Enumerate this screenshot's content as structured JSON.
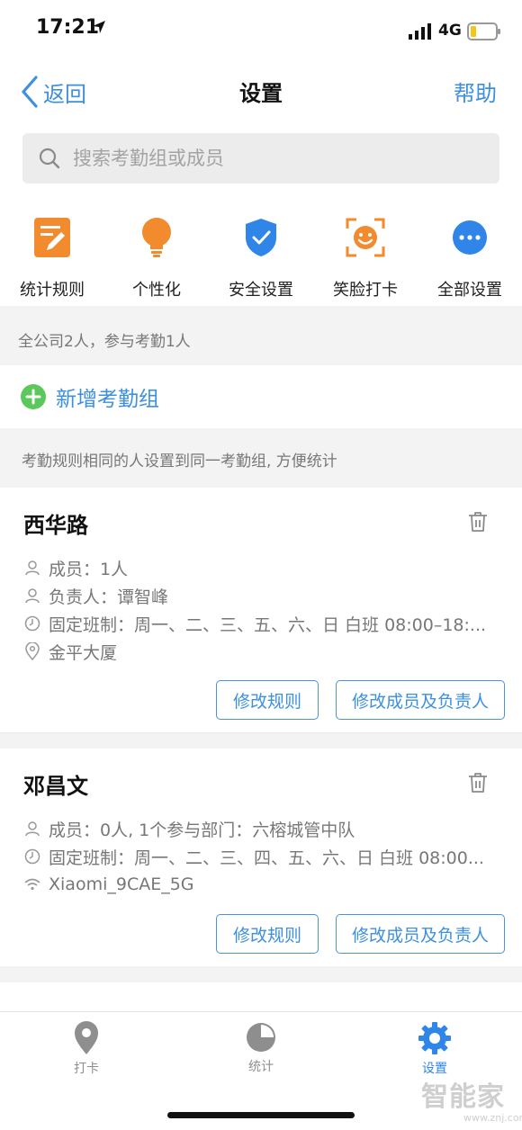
{
  "status_bar": {
    "time": "17:21",
    "network": "4G"
  },
  "nav": {
    "back_label": "返回",
    "title": "设置",
    "help_label": "帮助"
  },
  "search": {
    "placeholder": "搜索考勤组或成员"
  },
  "shortcuts": [
    {
      "label": "统计规则",
      "icon": "report-edit-icon",
      "color": "#f28a2e"
    },
    {
      "label": "个性化",
      "icon": "lightbulb-icon",
      "color": "#f28a2e"
    },
    {
      "label": "安全设置",
      "icon": "shield-check-icon",
      "color": "#2f86e8"
    },
    {
      "label": "笑脸打卡",
      "icon": "smile-face-icon",
      "color": "#f28a2e"
    },
    {
      "label": "全部设置",
      "icon": "more-icon",
      "color": "#2f86e8"
    }
  ],
  "summary": "全公司2人，参与考勤1人",
  "add_group_label": "新增考勤组",
  "hint": "考勤规则相同的人设置到同一考勤组, 方便统计",
  "groups": [
    {
      "name": "西华路",
      "members": "成员：1人",
      "manager": "负责人：谭智峰",
      "schedule": "固定班制：周一、二、三、五、六、日 白班 08:00–18:...",
      "location": "金平大厦",
      "edit_rules_label": "修改规则",
      "edit_members_label": "修改成员及负责人"
    },
    {
      "name": "邓昌文",
      "members": "成员：0人, 1个参与部门：六榕城管中队",
      "schedule": "固定班制：周一、二、三、四、五、六、日 白班 08:00...",
      "wifi": "Xiaomi_9CAE_5G",
      "edit_rules_label": "修改规则",
      "edit_members_label": "修改成员及负责人"
    }
  ],
  "tabs": [
    {
      "label": "打卡",
      "active": false
    },
    {
      "label": "统计",
      "active": false
    },
    {
      "label": "设置",
      "active": true
    }
  ],
  "colors": {
    "accent": "#3d8fe0",
    "orange": "#f28a2e",
    "green": "#5ac85a",
    "tab_inactive": "#8e8e8e"
  },
  "watermark": {
    "brand": "智能家",
    "url": "www.znj.com"
  }
}
